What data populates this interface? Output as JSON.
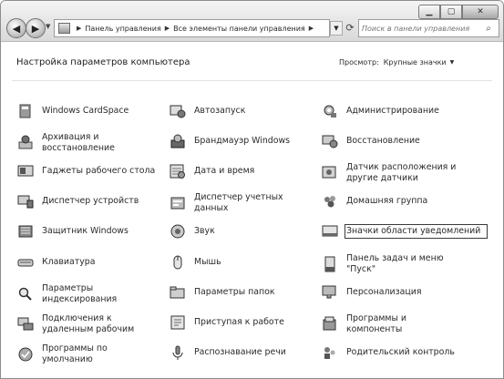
{
  "nav": {
    "back_icon": "back-arrow-icon",
    "forward_icon": "forward-arrow-icon",
    "breadcrumb": [
      "Панель управления",
      "Все элементы панели управления"
    ],
    "search_placeholder": "Поиск в панели управления"
  },
  "header": {
    "title": "Настройка параметров компьютера",
    "view_label": "Просмотр:",
    "view_value": "Крупные значки"
  },
  "items": [
    {
      "label": "Windows CardSpace",
      "icon": "cardspace-icon"
    },
    {
      "label": "Архивация и восстановление",
      "icon": "backup-icon"
    },
    {
      "label": "Гаджеты рабочего стола",
      "icon": "gadgets-icon"
    },
    {
      "label": "Диспетчер устройств",
      "icon": "device-manager-icon"
    },
    {
      "label": "Защитник Windows",
      "icon": "defender-icon"
    },
    {
      "label": "Клавиатура",
      "icon": "keyboard-icon"
    },
    {
      "label": "Параметры индексирования",
      "icon": "indexing-icon"
    },
    {
      "label": "Подключения к удаленным рабочим",
      "icon": "remote-desktop-icon"
    },
    {
      "label": "Программы по умолчанию",
      "icon": "default-programs-icon"
    },
    {
      "label": "Автозапуск",
      "icon": "autoplay-icon"
    },
    {
      "label": "Брандмауэр Windows",
      "icon": "firewall-icon"
    },
    {
      "label": "Дата и время",
      "icon": "datetime-icon"
    },
    {
      "label": "Диспетчер учетных данных",
      "icon": "credential-manager-icon"
    },
    {
      "label": "Звук",
      "icon": "sound-icon"
    },
    {
      "label": "Мышь",
      "icon": "mouse-icon"
    },
    {
      "label": "Параметры папок",
      "icon": "folder-options-icon"
    },
    {
      "label": "Приступая к работе",
      "icon": "getting-started-icon"
    },
    {
      "label": "Распознавание речи",
      "icon": "speech-icon"
    },
    {
      "label": "Администрирование",
      "icon": "admin-tools-icon"
    },
    {
      "label": "Восстановление",
      "icon": "recovery-icon"
    },
    {
      "label": "Датчик расположения и другие датчики",
      "icon": "location-sensor-icon"
    },
    {
      "label": "Домашняя группа",
      "icon": "homegroup-icon"
    },
    {
      "label": "Значки области уведомлений",
      "icon": "notification-icons-icon"
    },
    {
      "label": "Панель задач и меню \"Пуск\"",
      "icon": "taskbar-icon"
    },
    {
      "label": "Персонализация",
      "icon": "personalization-icon"
    },
    {
      "label": "Программы и компоненты",
      "icon": "programs-features-icon"
    },
    {
      "label": "Родительский контроль",
      "icon": "parental-controls-icon"
    }
  ]
}
